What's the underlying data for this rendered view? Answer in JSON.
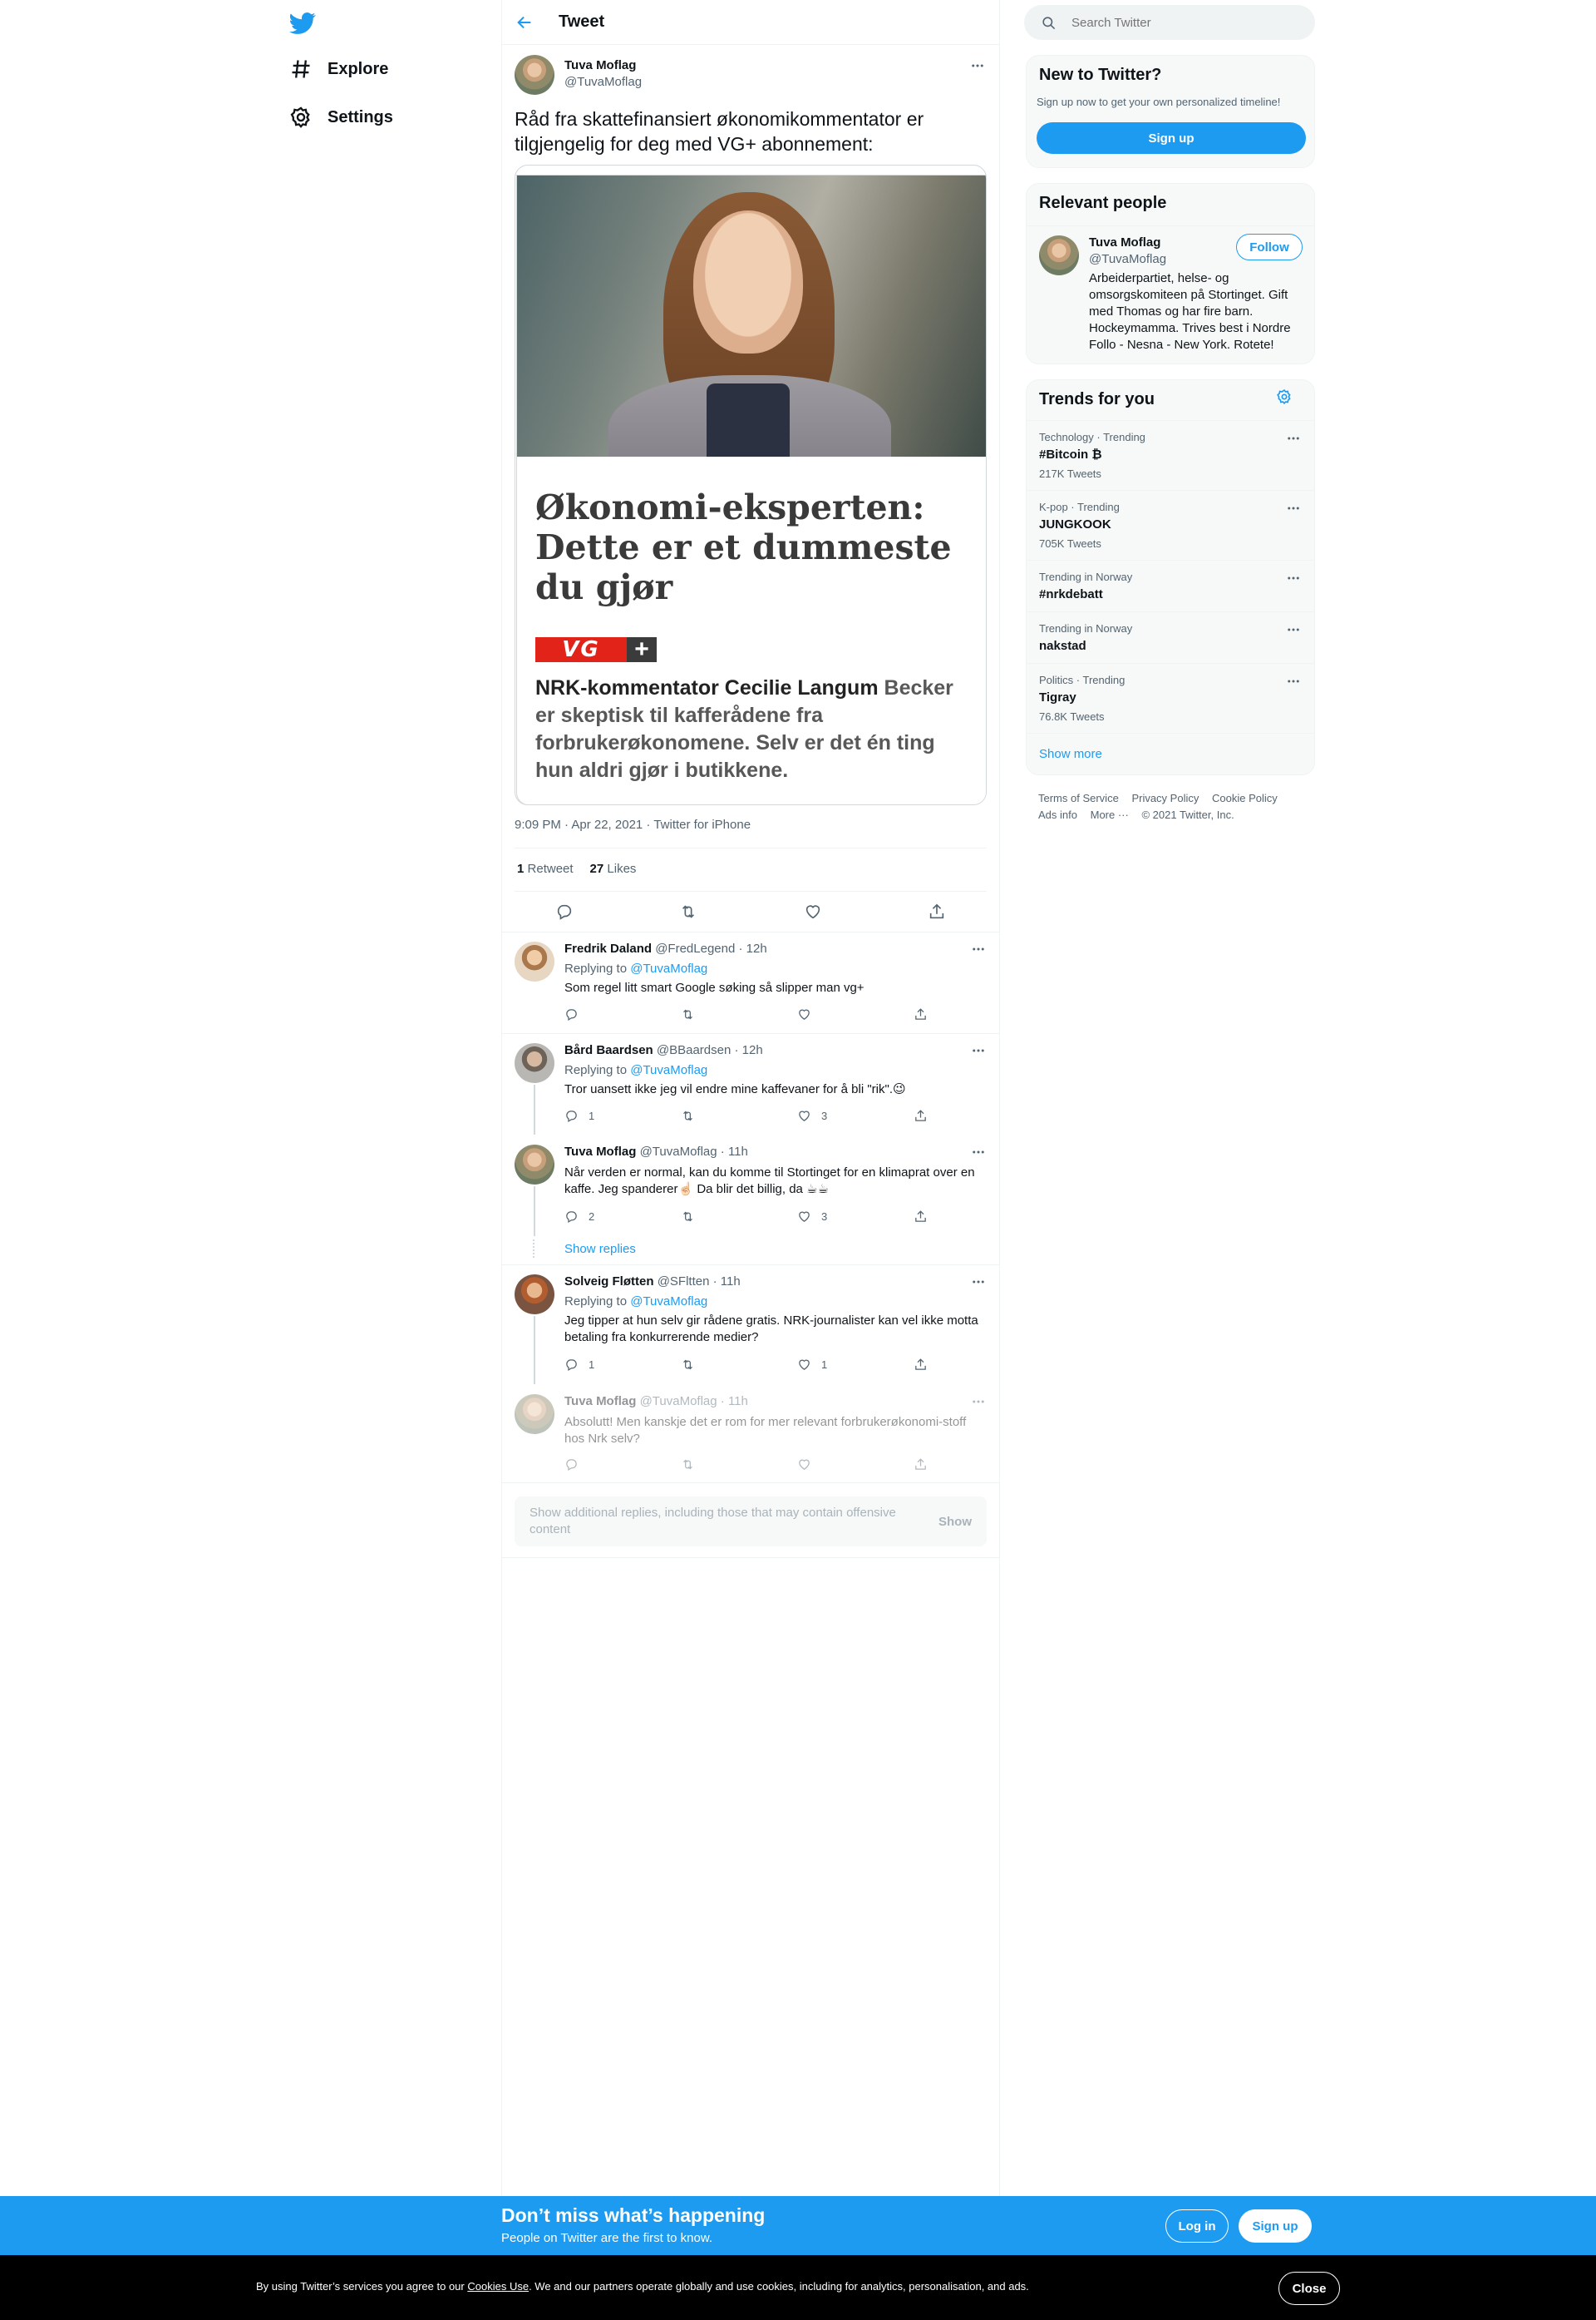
{
  "nav": {
    "logo_icon": "twitter-bird-icon",
    "items": [
      {
        "label": "Explore",
        "icon": "hashtag-icon"
      },
      {
        "label": "Settings",
        "icon": "gear-icon"
      }
    ]
  },
  "header": {
    "title": "Tweet"
  },
  "tweet": {
    "author_name": "Tuva Moflag",
    "author_handle": "@TuvaMoflag",
    "text": "Råd fra skattefinansiert økonomikommentator er tilgjengelig for deg med VG+ abonnement:",
    "card": {
      "headline": "Økonomi-eksperten: Dette er et dummeste du gjør",
      "brand": "VG",
      "brand_plus": "+",
      "desc_bold": "NRK-kommentator Cecilie Langum",
      "desc_rest": " Becker er skeptisk til kafferådene fra forbrukerøkonomene. Selv er det én ting hun aldri gjør i butikkene."
    },
    "meta": "9:09 PM · Apr 22, 2021 · Twitter for iPhone",
    "retweets": "1",
    "retweets_label": "Retweet",
    "likes": "27",
    "likes_label": "Likes"
  },
  "replies": [
    {
      "name": "Fredrik Daland",
      "handle": "@FredLegend",
      "time": "· 12h",
      "replying_prefix": "Replying to ",
      "replying_to": "@TuvaMoflag",
      "text": "Som regel litt smart Google søking så slipper man vg+",
      "reply_count": "",
      "retweet_count": "",
      "like_count": ""
    },
    {
      "name": "Bård Baardsen",
      "handle": "@BBaardsen",
      "time": "· 12h",
      "replying_prefix": "Replying to ",
      "replying_to": "@TuvaMoflag",
      "text": "Tror uansett ikke jeg vil endre mine kaffevaner for å bli \"rik\".😉",
      "reply_count": "1",
      "retweet_count": "",
      "like_count": "3"
    },
    {
      "name": "Tuva Moflag",
      "handle": "@TuvaMoflag",
      "time": "· 11h",
      "text": "Når verden er normal, kan du komme til Stortinget for en klimaprat over en kaffe. Jeg spanderer☝🏻 Da blir det billig, da ☕☕",
      "reply_count": "2",
      "retweet_count": "",
      "like_count": "3"
    },
    {
      "name": "Solveig Fløtten",
      "handle": "@SFltten",
      "time": "· 11h",
      "replying_prefix": "Replying to ",
      "replying_to": "@TuvaMoflag",
      "text": "Jeg tipper at hun selv gir rådene gratis. NRK-journalister kan vel ikke motta betaling fra konkurrerende medier?",
      "reply_count": "1",
      "retweet_count": "",
      "like_count": "1"
    },
    {
      "name": "Tuva Moflag",
      "handle": "@TuvaMoflag",
      "time": "· 11h",
      "text": "Absolutt! Men kanskje det er rom for mer relevant forbrukerøkonomi-stoff hos Nrk selv?",
      "reply_count": "",
      "retweet_count": "",
      "like_count": ""
    }
  ],
  "show_replies": "Show replies",
  "show_additional": {
    "text": "Show additional replies, including those that may contain offensive content",
    "button": "Show"
  },
  "sidebar": {
    "search_placeholder": "Search Twitter",
    "new_to_twitter": {
      "title": "New to Twitter?",
      "subtitle": "Sign up now to get your own personalized timeline!",
      "button": "Sign up"
    },
    "relevant": {
      "title": "Relevant people",
      "name": "Tuva Moflag",
      "handle": "@TuvaMoflag",
      "follow": "Follow",
      "bio": "Arbeiderpartiet, helse- og omsorgskomiteen på Stortinget. Gift med Thomas og har fire barn. Hockeymamma. Trives best i Nordre Follo - Nesna - New York. Rotete!"
    },
    "trends": {
      "title": "Trends for you",
      "items": [
        {
          "context": "Technology · Trending",
          "title": "#Bitcoin ₿",
          "count": "217K Tweets"
        },
        {
          "context": "K-pop · Trending",
          "title": "JUNGKOOK",
          "count": "705K Tweets"
        },
        {
          "context": "Trending in Norway",
          "title": "#nrkdebatt",
          "count": ""
        },
        {
          "context": "Trending in Norway",
          "title": "nakstad",
          "count": ""
        },
        {
          "context": "Politics · Trending",
          "title": "Tigray",
          "count": "76.8K Tweets"
        }
      ],
      "show_more": "Show more"
    },
    "footer": [
      "Terms of Service",
      "Privacy Policy",
      "Cookie Policy",
      "Ads info",
      "More ···",
      "© 2021 Twitter, Inc."
    ]
  },
  "bottom_bar": {
    "title": "Don’t miss what’s happening",
    "subtitle": "People on Twitter are the first to know.",
    "login": "Log in",
    "signup": "Sign up"
  },
  "cookie_bar": {
    "prefix": "By using Twitter’s services you agree to our ",
    "link": "Cookies Use",
    "suffix": ". We and our partners operate globally and use cookies, including for analytics, personalisation, and ads.",
    "close": "Close"
  },
  "colors": {
    "accent": "#1d9bf0",
    "text": "#0f1419",
    "muted": "#536471"
  }
}
